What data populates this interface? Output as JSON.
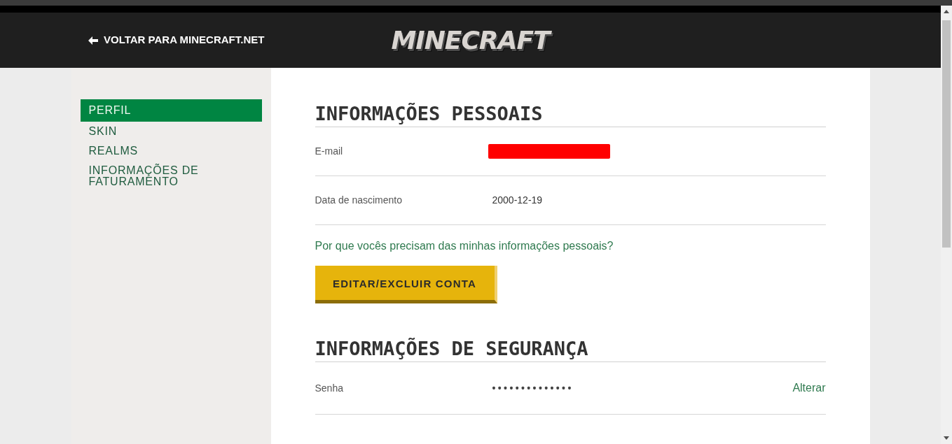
{
  "top_bar": {
    "back_link": "VOLTAR PARA MINECRAFT.NET",
    "logo": "MINECRAFT"
  },
  "sidebar": {
    "items": [
      {
        "label": "PERFIL",
        "selected": true
      },
      {
        "label": "SKIN",
        "selected": false
      },
      {
        "label": "REALMS",
        "selected": false
      },
      {
        "label": "INFORMAÇÕES DE FATURAMENTO",
        "selected": false
      }
    ]
  },
  "sections": [
    {
      "title": "INFORMAÇÕES PESSOAIS",
      "rows": [
        {
          "kind": "redacted",
          "label": "E-mail"
        },
        {
          "kind": "text",
          "label": "Data de nascimento",
          "value": "2000-12-19"
        }
      ],
      "link": "Por que vocês precisam das minhas informações pessoais?",
      "button": "EDITAR/EXCLUIR CONTA"
    },
    {
      "title": "INFORMAÇÕES DE SEGURANÇA",
      "rows": [
        {
          "kind": "password",
          "label": "Senha",
          "value": "••••••••••••••",
          "action": "Alterar"
        }
      ]
    }
  ]
}
